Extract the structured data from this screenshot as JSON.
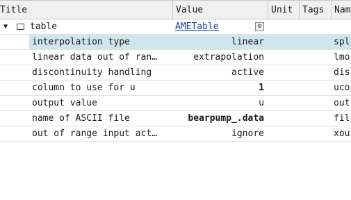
{
  "columns": {
    "title": "Title",
    "value": "Value",
    "unit": "Unit",
    "tags": "Tags",
    "name": "Nam"
  },
  "group": {
    "label": "table",
    "value_link": "AMETable",
    "expanded": true
  },
  "rows": [
    {
      "title": "interpolation type",
      "value": "linear",
      "name": "spl",
      "selected": true
    },
    {
      "title": "linear data out of ran…",
      "value": "extrapolation",
      "name": "lmo"
    },
    {
      "title": "discontinuity handling",
      "value": "active",
      "name": "dis"
    },
    {
      "title": "column to use for u",
      "value": "1",
      "name": "uco",
      "bold": true
    },
    {
      "title": "output value",
      "value": "u",
      "name": "out"
    },
    {
      "title": "name of ASCII file",
      "value": "bearpump_.data",
      "name": "fil",
      "bold": true
    },
    {
      "title": "out of range input act…",
      "value": "ignore",
      "name": "xou"
    }
  ],
  "icons": {
    "expander": "chevron-down-icon",
    "folder": "folder-icon",
    "edit": "edit-table-icon"
  },
  "colors": {
    "selection": "#cfe6ee",
    "link": "#1a3fa8",
    "header_bg": "#f0f0f0"
  }
}
